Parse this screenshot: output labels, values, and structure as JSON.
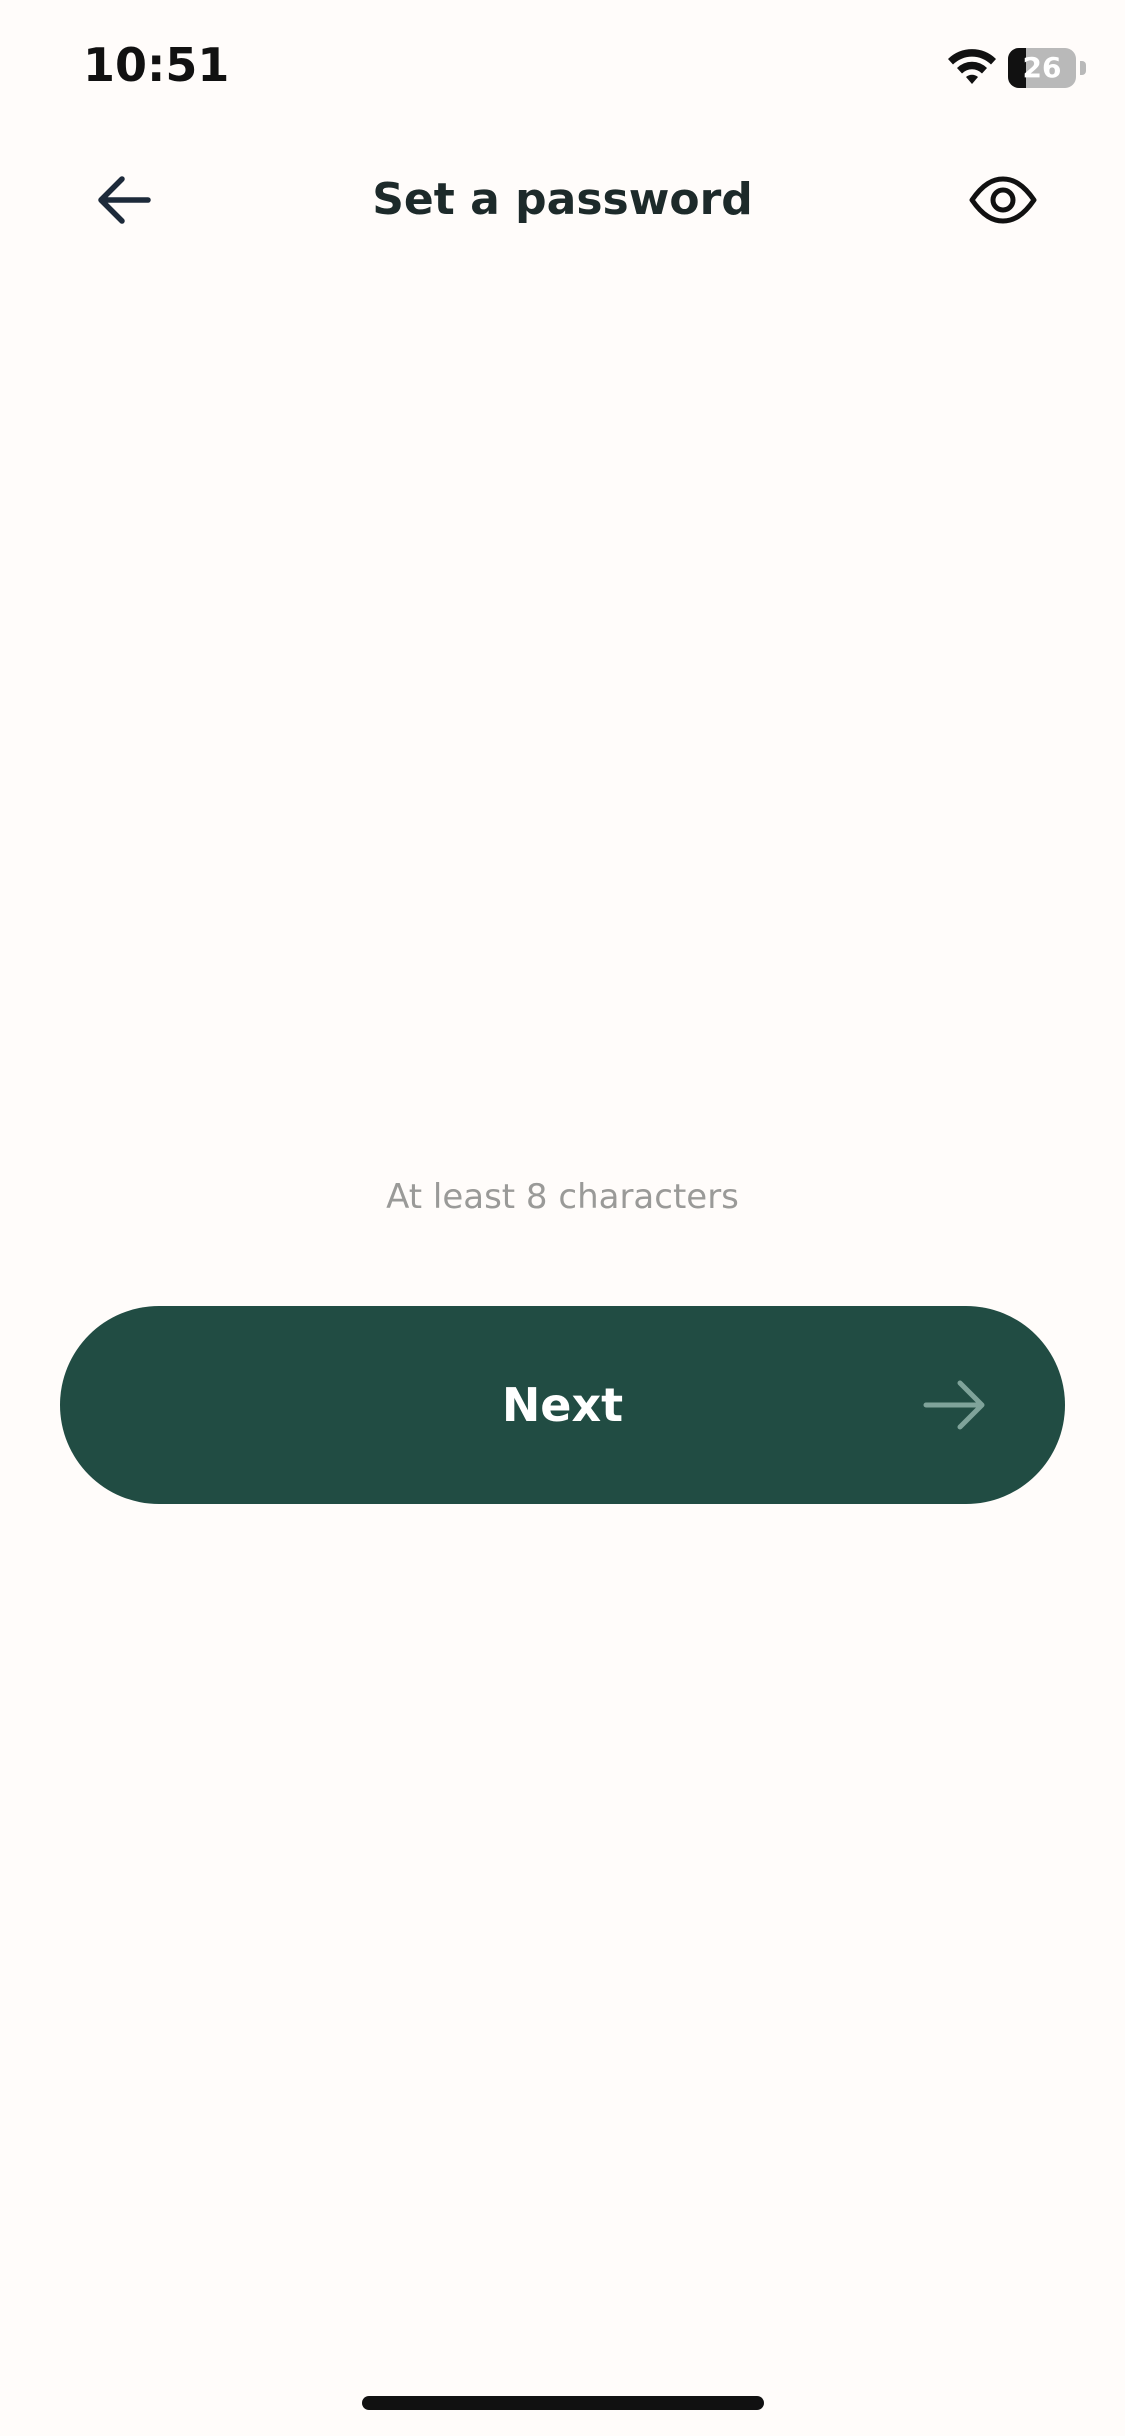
{
  "status_bar": {
    "time": "10:51",
    "battery_level": "26",
    "icons": [
      "wifi-icon",
      "battery-icon"
    ]
  },
  "header": {
    "title": "Set a password",
    "back_icon": "arrow-left-icon",
    "visibility_icon": "eye-icon"
  },
  "password_field": {
    "value": "",
    "placeholder": ""
  },
  "hint": "At least 8 characters",
  "next_button": {
    "label": "Next",
    "icon": "arrow-right-icon"
  },
  "colors": {
    "background": "#fffcfa",
    "primary": "#214c43",
    "title_text": "#1d2a2a",
    "hint_text": "#9a9a98",
    "button_arrow": "#7fa39a"
  }
}
